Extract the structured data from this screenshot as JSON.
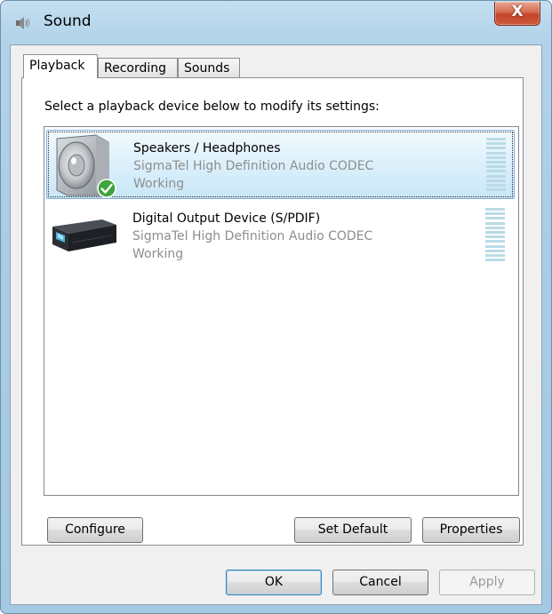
{
  "window": {
    "title": "Sound",
    "close_label": "X"
  },
  "tabs": [
    {
      "label": "Playback",
      "active": true
    },
    {
      "label": "Recording",
      "active": false
    },
    {
      "label": "Sounds",
      "active": false
    }
  ],
  "panel": {
    "instruction": "Select a playback device below to modify its settings:"
  },
  "devices": [
    {
      "name": "Speakers / Headphones",
      "driver": "SigmaTel High Definition Audio CODEC",
      "status": "Working",
      "icon": "speaker-icon",
      "is_default": true,
      "selected": true
    },
    {
      "name": "Digital Output Device (S/PDIF)",
      "driver": "SigmaTel High Definition Audio CODEC",
      "status": "Working",
      "icon": "digital-output-icon",
      "is_default": false,
      "selected": false
    }
  ],
  "panel_buttons": {
    "configure": "Configure",
    "set_default": "Set Default",
    "properties": "Properties"
  },
  "dialog_buttons": {
    "ok": "OK",
    "cancel": "Cancel",
    "apply": "Apply",
    "apply_disabled": true
  },
  "colors": {
    "selection_border": "#84acdd",
    "meter": "#b9dbe6",
    "check_green": "#3fa43a"
  }
}
